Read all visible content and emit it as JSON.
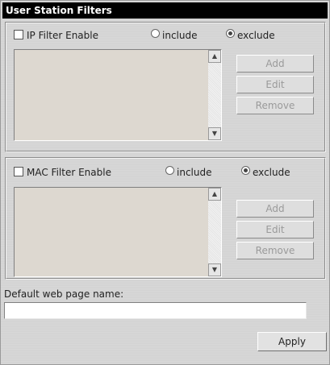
{
  "panel": {
    "title": "User Station Filters"
  },
  "ip_filter": {
    "enable_label": "IP Filter Enable",
    "include_label": "include",
    "exclude_label": "exclude",
    "selected": "exclude",
    "enabled": false,
    "items": [],
    "buttons": {
      "add": "Add",
      "edit": "Edit",
      "remove": "Remove"
    }
  },
  "mac_filter": {
    "enable_label": "MAC Filter Enable",
    "include_label": "include",
    "exclude_label": "exclude",
    "selected": "exclude",
    "enabled": false,
    "items": [],
    "buttons": {
      "add": "Add",
      "edit": "Edit",
      "remove": "Remove"
    }
  },
  "web_page": {
    "label": "Default web page name:",
    "value": ""
  },
  "apply_label": "Apply",
  "icons": {
    "scroll_up": "scroll-up-arrow-icon",
    "scroll_down": "scroll-down-arrow-icon"
  }
}
